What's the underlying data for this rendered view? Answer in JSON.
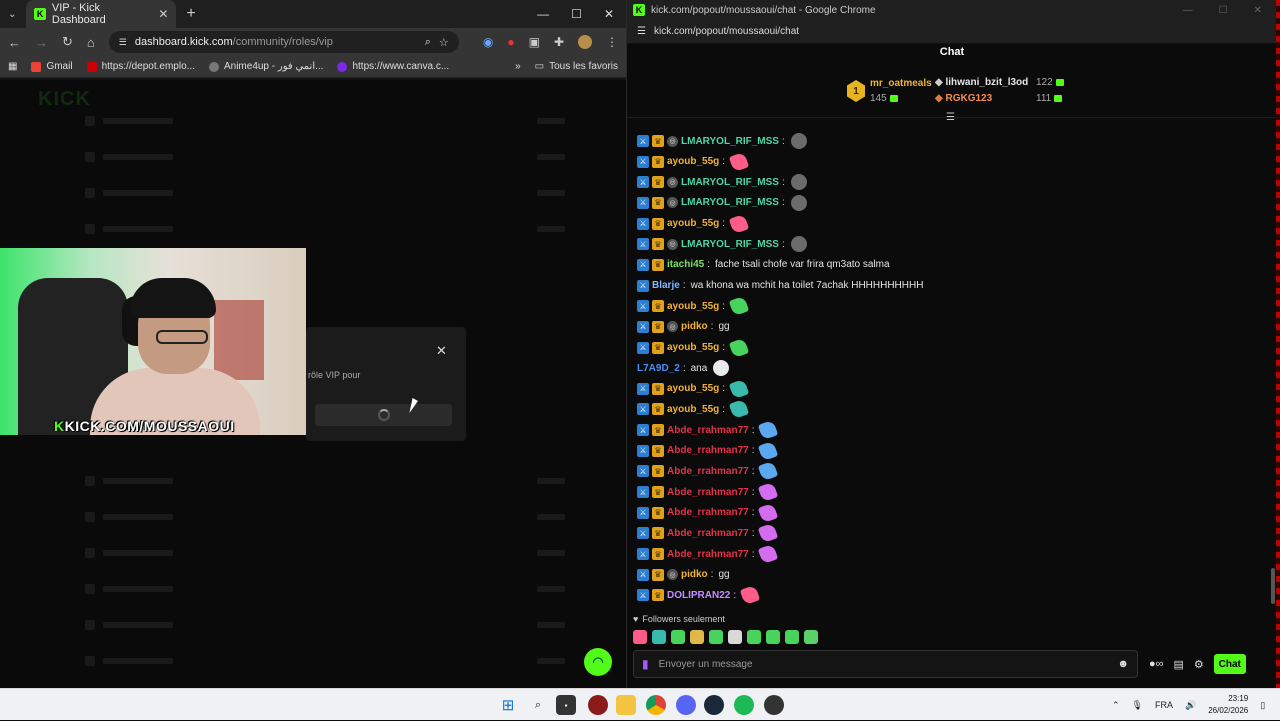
{
  "left_window": {
    "tab_title": "VIP - Kick Dashboard",
    "url_host": "dashboard.kick.com",
    "url_path": "/community/roles/vip",
    "bookmarks": [
      {
        "label": "Gmail",
        "color": "#ea4335"
      },
      {
        "label": "https://depot.emplo...",
        "color": "#cc0000"
      },
      {
        "label": "Anime4up - انمي فور...",
        "color": "#777777"
      },
      {
        "label": "https://www.canva.c...",
        "color": "#7d2ae8"
      }
    ],
    "bookmarks_all": "Tous les favoris",
    "modal_text": "rôle VIP pour",
    "stream_banner": "KICK.COM/MOUSSAOUI"
  },
  "right_window": {
    "title_bar": "kick.com/popout/moussaoui/chat - Google Chrome",
    "address": "kick.com/popout/moussaoui/chat",
    "chat_title": "Chat",
    "leaderboard": {
      "first": {
        "rank": "1",
        "name": "mr_oatmeals",
        "count": "145"
      },
      "second": {
        "name": "lihwani_bzit_l3od",
        "count": "122"
      },
      "third": {
        "name": "RGKG123",
        "count": "111"
      }
    },
    "messages": [
      {
        "user": "LMARYOL_RIF_MSS",
        "color": "#4fd6a5",
        "badges": [
          "mod",
          "vip",
          "og"
        ],
        "text": "",
        "emote": "wolf"
      },
      {
        "user": "ayoub_55g",
        "color": "#f2b233",
        "badges": [
          "mod",
          "vip"
        ],
        "text": "",
        "emote": "pink"
      },
      {
        "user": "LMARYOL_RIF_MSS",
        "color": "#4fd6a5",
        "badges": [
          "mod",
          "vip",
          "og"
        ],
        "text": "",
        "emote": "wolf"
      },
      {
        "user": "LMARYOL_RIF_MSS",
        "color": "#4fd6a5",
        "badges": [
          "mod",
          "vip",
          "og"
        ],
        "text": "",
        "emote": "wolf"
      },
      {
        "user": "ayoub_55g",
        "color": "#f2b233",
        "badges": [
          "mod",
          "vip"
        ],
        "text": "",
        "emote": "pink"
      },
      {
        "user": "LMARYOL_RIF_MSS",
        "color": "#4fd6a5",
        "badges": [
          "mod",
          "vip",
          "og"
        ],
        "text": "",
        "emote": "wolf"
      },
      {
        "user": "itachi45",
        "color": "#7ee05a",
        "badges": [
          "mod",
          "vip"
        ],
        "text": "fache tsali chofe var frira qm3ato salma",
        "emote": ""
      },
      {
        "user": "Blarje",
        "color": "#7fb8ff",
        "badges": [
          "mod"
        ],
        "text": "wa khona wa mchit ha toilet 7achak HHHHHHHHHH",
        "emote": ""
      },
      {
        "user": "ayoub_55g",
        "color": "#f2b233",
        "badges": [
          "mod",
          "vip"
        ],
        "text": "",
        "emote": "green"
      },
      {
        "user": "pidko",
        "color": "#f2b233",
        "badges": [
          "mod",
          "vip",
          "og"
        ],
        "text": "gg",
        "emote": ""
      },
      {
        "user": "ayoub_55g",
        "color": "#f2b233",
        "badges": [
          "mod",
          "vip"
        ],
        "text": "",
        "emote": "green"
      },
      {
        "user": "L7A9D_2",
        "color": "#4a8ef0",
        "badges": [],
        "text": "ana",
        "emote": "ghost"
      },
      {
        "user": "ayoub_55g",
        "color": "#f2b233",
        "badges": [
          "mod",
          "vip"
        ],
        "text": "",
        "emote": "teal"
      },
      {
        "user": "ayoub_55g",
        "color": "#f2b233",
        "badges": [
          "mod",
          "vip"
        ],
        "text": "",
        "emote": "teal"
      },
      {
        "user": "Abde_rrahman77",
        "color": "#e0344a",
        "badges": [
          "mod",
          "vip"
        ],
        "text": "",
        "emote": "blue"
      },
      {
        "user": "Abde_rrahman77",
        "color": "#e0344a",
        "badges": [
          "mod",
          "vip"
        ],
        "text": "",
        "emote": "blue"
      },
      {
        "user": "Abde_rrahman77",
        "color": "#e0344a",
        "badges": [
          "mod",
          "vip"
        ],
        "text": "",
        "emote": "blue"
      },
      {
        "user": "Abde_rrahman77",
        "color": "#e0344a",
        "badges": [
          "mod",
          "vip"
        ],
        "text": "",
        "emote": "violet"
      },
      {
        "user": "Abde_rrahman77",
        "color": "#e0344a",
        "badges": [
          "mod",
          "vip"
        ],
        "text": "",
        "emote": "violet"
      },
      {
        "user": "Abde_rrahman77",
        "color": "#e0344a",
        "badges": [
          "mod",
          "vip"
        ],
        "text": "",
        "emote": "violet"
      },
      {
        "user": "Abde_rrahman77",
        "color": "#e0344a",
        "badges": [
          "mod",
          "vip"
        ],
        "text": "",
        "emote": "violet"
      },
      {
        "user": "pidko",
        "color": "#f2b233",
        "badges": [
          "mod",
          "vip",
          "og"
        ],
        "text": "gg",
        "emote": ""
      },
      {
        "user": "DOLIPRAN22",
        "color": "#c68cff",
        "badges": [
          "mod",
          "vip"
        ],
        "text": "",
        "emote": "pink"
      }
    ],
    "followers_only": "Followers seulement",
    "input_placeholder": "Envoyer un message",
    "chat_button": "Chat"
  },
  "taskbar": {
    "language": "FRA",
    "time": "23:19",
    "date": "26/02/2026"
  },
  "colors": {
    "kick_green": "#53fc18",
    "mod_badge": "#2c7fd0",
    "vip_badge": "#e0a21a"
  }
}
